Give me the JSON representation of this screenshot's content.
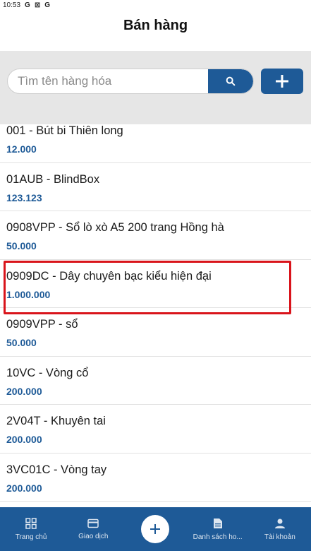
{
  "status_bar": {
    "time": "10:53",
    "icons": [
      "G",
      "⊠",
      "G"
    ]
  },
  "header": {
    "title": "Bán hàng"
  },
  "search": {
    "placeholder": "Tìm tên hàng hóa",
    "value": ""
  },
  "products": [
    {
      "name": "001 - Bút bi Thiên long",
      "price": "12.000"
    },
    {
      "name": "01AUB - BlindBox",
      "price": "123.123"
    },
    {
      "name": "0908VPP - Sổ lò xò A5 200 trang Hồng hà",
      "price": "50.000"
    },
    {
      "name": "0909DC - Dây chuyên bạc kiểu hiện đại",
      "price": "1.000.000"
    },
    {
      "name": "0909VPP - sổ",
      "price": "50.000"
    },
    {
      "name": "10VC - Vòng cổ",
      "price": "200.000"
    },
    {
      "name": "2V04T - Khuyên tai",
      "price": "200.000"
    },
    {
      "name": "3VC01C - Vòng tay",
      "price": "200.000"
    }
  ],
  "bottom_nav": {
    "home": "Trang chủ",
    "transactions": "Giao dịch",
    "list": "Danh sách ho...",
    "account": "Tài khoản"
  },
  "colors": {
    "primary": "#1e5a97",
    "highlight": "#d9141b",
    "search_bg": "#e6e6e6"
  }
}
